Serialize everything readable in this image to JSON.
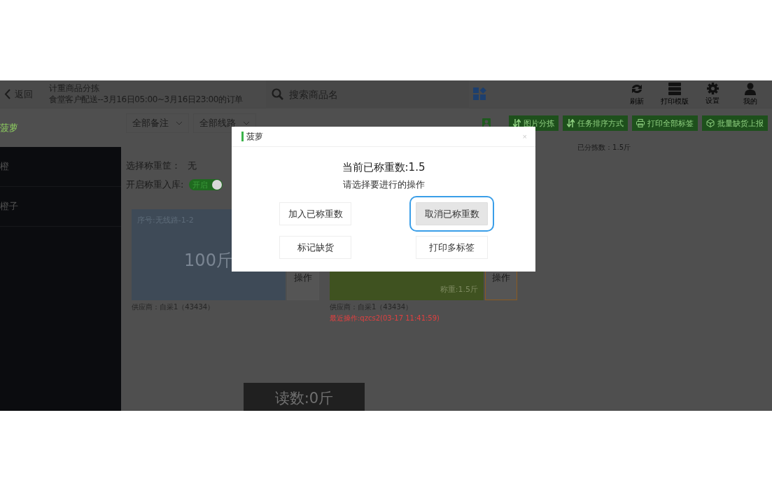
{
  "header": {
    "back": "返回",
    "title": "计重商品分拣",
    "subtitle": "食堂客户配送--3月16日05:00~3月16日23:00的订单",
    "search": {
      "placeholder": "搜索商品名"
    },
    "tools": [
      {
        "kind": "refresh",
        "label": "刷新"
      },
      {
        "kind": "server",
        "label": "打印模版"
      },
      {
        "kind": "gear",
        "label": "设置"
      },
      {
        "kind": "user",
        "label": "我的"
      }
    ]
  },
  "sidebar": {
    "items": [
      {
        "label": "菠萝",
        "selected": true
      },
      {
        "label": "橙",
        "selected": false
      },
      {
        "label": "橙子",
        "selected": false
      }
    ]
  },
  "filters": [
    {
      "label": "全部备注",
      "kind": "dropdown"
    },
    {
      "label": "全部线路",
      "kind": "dropdown"
    }
  ],
  "actions": [
    {
      "kind": "sort",
      "label": "图片分拣"
    },
    {
      "kind": "sort",
      "label": "任务排序方式"
    },
    {
      "kind": "print",
      "label": "打印全部标签"
    },
    {
      "kind": "box",
      "label": "批量缺货上报"
    }
  ],
  "sorted_count": "已分拣数：1.5斤",
  "basket": {
    "label": "选择称重筐：",
    "value": "无"
  },
  "auto_stock": {
    "label": "开启称重入库:",
    "on": true,
    "text": "开启"
  },
  "cards": [
    {
      "done": false,
      "title": "序号:无线路-1-2",
      "amount": "100斤",
      "action": "操作",
      "selected": false,
      "supplier": "供应商：自采1（43434）"
    },
    {
      "done": true,
      "weighed": "称重:1.5斤",
      "action": "操作",
      "selected": true,
      "supplier": "供应商：自采1（43434）",
      "last_op": "最近操作:qzcs2(03-17 11:41:59)"
    }
  ],
  "reading": "读数:0斤",
  "dialog": {
    "title": "菠萝",
    "close": "×",
    "current": "当前已称重数:1.5",
    "prompt": "请选择要进行的操作",
    "buttons": [
      {
        "label": "加入已称重数",
        "selected": false
      },
      {
        "label": "取消已称重数",
        "selected": true
      },
      {
        "label": "标记缺货",
        "selected": false
      },
      {
        "label": "打印多标签",
        "selected": false
      }
    ]
  }
}
